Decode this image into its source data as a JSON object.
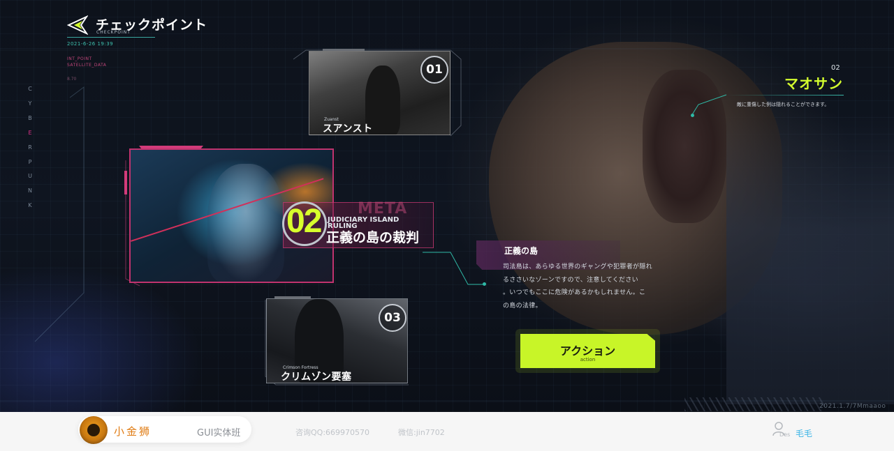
{
  "header": {
    "title": "チェックポイント",
    "subtitle": "CHECKPOINT",
    "date": "2021-6-26  19:39",
    "sys_lines": [
      "INT_POINT",
      "SATELLITE_DATA"
    ],
    "sys_small": "8.70",
    "vertical_letters": [
      "C",
      "Y",
      "B",
      "E",
      "R",
      "P",
      "U",
      "N",
      "K"
    ]
  },
  "cards": [
    {
      "number": "01",
      "en": "Zuanst",
      "jp": "スアンスト"
    },
    {
      "number": "02",
      "en": "JUDICIARY ISLAND RULING",
      "jp": "正義の島の裁判",
      "overlay": "META"
    },
    {
      "number": "03",
      "en": "Crimson Fortress",
      "jp": "クリムゾン要塞"
    }
  ],
  "description": {
    "title": "正義の島",
    "lines": [
      "司法島は、あらゆる世界のギャングや犯罪者が隠れ",
      "るささいなゾーンですので、注意してください",
      "。いつでもここに危険があるかもしれません。こ",
      "の島の法律。"
    ]
  },
  "character": {
    "number": "02",
    "name": "マオサン",
    "desc": "敵に重傷した例は隠れることができます。"
  },
  "action": {
    "label": "アクション",
    "sub": "action"
  },
  "watermark": "2021.1.7/7Mmaaoo",
  "footer": {
    "brand": "小金狮",
    "course": "GUI实体班",
    "qq": "咨询QQ:669970570",
    "wechat": "微信:jin7702",
    "des": "Des",
    "user": "毛毛"
  },
  "colors": {
    "accent": "#d5ff2e",
    "magenta": "#d23b7a",
    "teal": "#2fb9a6",
    "brand": "#e07b12"
  }
}
